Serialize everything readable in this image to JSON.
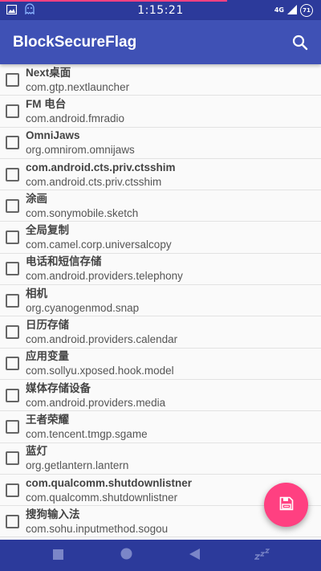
{
  "status_bar": {
    "time": "1:15:21",
    "signal_label": "4G",
    "battery_level": "71"
  },
  "app_bar": {
    "title": "BlockSecureFlag",
    "search_icon": "search-icon"
  },
  "apps": [
    {
      "name": "Next桌面",
      "package": "com.gtp.nextlauncher",
      "checked": false
    },
    {
      "name": "FM 电台",
      "package": "com.android.fmradio",
      "checked": false
    },
    {
      "name": "OmniJaws",
      "package": "org.omnirom.omnijaws",
      "checked": false
    },
    {
      "name": "com.android.cts.priv.ctsshim",
      "package": "com.android.cts.priv.ctsshim",
      "checked": false
    },
    {
      "name": "涂画",
      "package": "com.sonymobile.sketch",
      "checked": false
    },
    {
      "name": "全局复制",
      "package": "com.camel.corp.universalcopy",
      "checked": false
    },
    {
      "name": "电话和短信存储",
      "package": "com.android.providers.telephony",
      "checked": false
    },
    {
      "name": "相机",
      "package": "org.cyanogenmod.snap",
      "checked": false
    },
    {
      "name": "日历存储",
      "package": "com.android.providers.calendar",
      "checked": false
    },
    {
      "name": "应用变量",
      "package": "com.sollyu.xposed.hook.model",
      "checked": false
    },
    {
      "name": "媒体存储设备",
      "package": "com.android.providers.media",
      "checked": false
    },
    {
      "name": "王者荣耀",
      "package": "com.tencent.tmgp.sgame",
      "checked": false
    },
    {
      "name": "蓝灯",
      "package": "org.getlantern.lantern",
      "checked": false
    },
    {
      "name": "com.qualcomm.shutdownlistner",
      "package": "com.qualcomm.shutdownlistner",
      "checked": false
    },
    {
      "name": "搜狗输入法",
      "package": "com.sohu.inputmethod.sogou",
      "checked": false
    }
  ],
  "fab": {
    "icon": "save-icon"
  },
  "colors": {
    "primary": "#3f51b5",
    "primary_dark": "#2c3a9b",
    "accent": "#ff4081"
  }
}
